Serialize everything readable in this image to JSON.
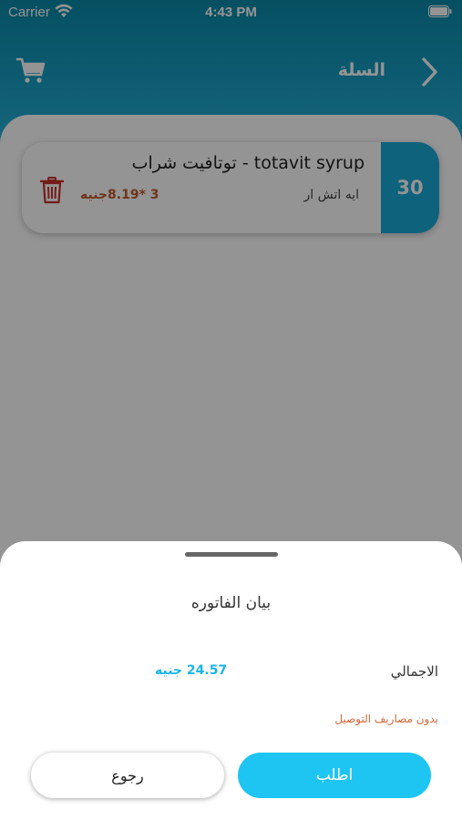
{
  "status_bar": {
    "carrier": "Carrier",
    "time": "4:43 PM"
  },
  "header": {
    "title": "السلة",
    "back_icon": "chevron-right-icon",
    "cart_icon": "cart-icon"
  },
  "cart": {
    "items": [
      {
        "quantity": "30",
        "name": "توتافيت شراب - totavit syrup",
        "brand": "ايه اتش ار",
        "price": "3 *8.19جنيه",
        "delete_icon": "trash-icon"
      }
    ]
  },
  "invoice_sheet": {
    "title": "بيان الفاتوره",
    "total_label": "الاجمالي",
    "total_value": "24.57 جنيه",
    "delivery_note": "بدون مصاريف التوصيل",
    "back_button": "رجوع",
    "order_button": "اطلب"
  },
  "colors": {
    "accent": "#1ec5f2",
    "header": "#1aa2c8",
    "price": "#c05a2c",
    "delivery_note": "#d2693a",
    "total_value": "#19b6e6",
    "trash": "#c8322c"
  }
}
